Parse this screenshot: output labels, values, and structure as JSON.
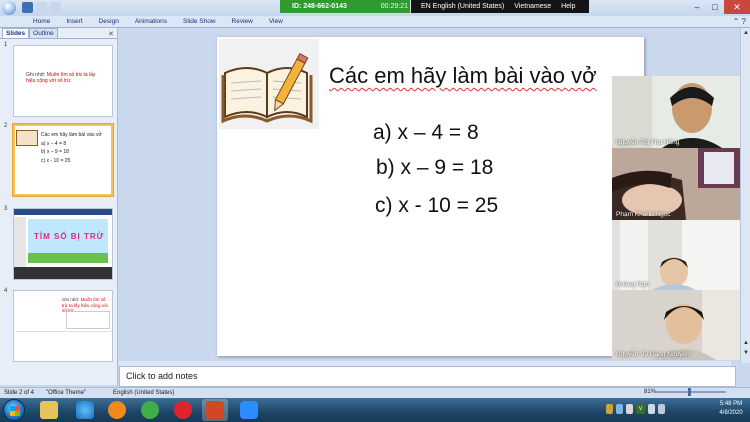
{
  "zoom_meeting": {
    "id_label": "ID: 248-662-0143",
    "elapsed": "00:29:21"
  },
  "language_bar": {
    "input_lang": "EN English (United States)",
    "keyboard": "Vietnamese",
    "help": "Help"
  },
  "ribbon_tabs": [
    "Home",
    "Insert",
    "Design",
    "Animations",
    "Slide Show",
    "Review",
    "View"
  ],
  "panel_tabs": {
    "slides": "Slides",
    "outline": "Outline"
  },
  "thumbnails": [
    {
      "num": "1",
      "prefix": "Ghi nhớ:",
      "red": "Muốn tìm số trừ ta lấy hiệu cộng với số trừ."
    },
    {
      "num": "2",
      "title": "Các em hãy làm bài vào vở",
      "lines": [
        "a) x – 4 = 8",
        "b) x – 9 = 18",
        "c) x - 10 = 25"
      ]
    },
    {
      "num": "3",
      "game_title": "TÌM SỐ BỊ TRỪ"
    },
    {
      "num": "4",
      "prefix": "Ghi nhớ:",
      "red": "Muốn tìm số trừ ta lấy hiệu cộng với số trừ."
    }
  ],
  "slide": {
    "title": "Các em hãy làm bài vào vở",
    "equations": [
      "a) x – 4 = 8",
      "b) x – 9 = 18",
      "c) x - 10 = 25"
    ]
  },
  "notes_placeholder": "Click to add notes",
  "status": {
    "slide_info": "Slide 2 of 4",
    "theme": "\"Office Theme\"",
    "language": "English (United States)",
    "zoom": "81%"
  },
  "participants": [
    "Nguyễn Thị Thu Hồng",
    "Phạm Khánh Ngọc",
    "Hoàng Ngh",
    "Nguyễn Vũ Đăng Nguyên"
  ],
  "clock": {
    "time": "5:48 PM",
    "date": "4/8/2020"
  },
  "colors": {
    "zoom_green": "#2f9b2f",
    "accent_red": "#d00000",
    "selection_orange": "#f4c257"
  }
}
